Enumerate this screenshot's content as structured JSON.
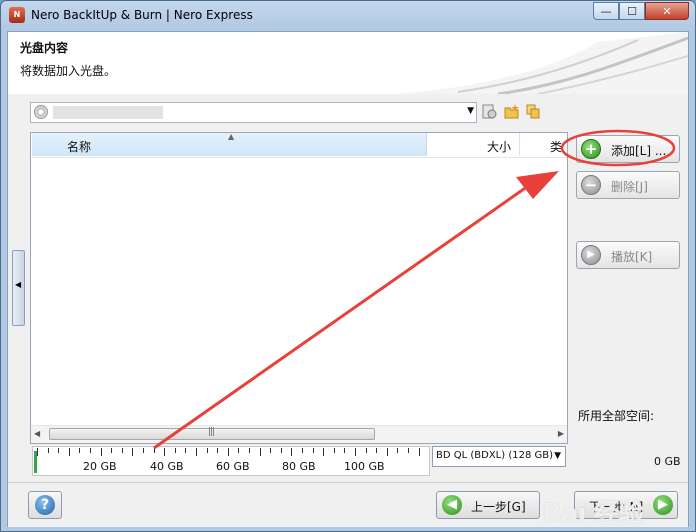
{
  "window": {
    "title": "Nero BackItUp & Burn | Nero Express",
    "app_icon": "nero-icon",
    "controls": {
      "minimize": "—",
      "maximize": "☐",
      "close": "✕"
    }
  },
  "header": {
    "title": "光盘内容",
    "subtitle": "将数据加入光盘。"
  },
  "source": {
    "value": "███████"
  },
  "table": {
    "columns": [
      "名称",
      "大小",
      "类"
    ],
    "rows": []
  },
  "buttons": {
    "add": "添加[L] ...",
    "delete": "删除[J]",
    "play": "播放[K]"
  },
  "space": {
    "label": "所用全部空间:",
    "value": "0 GB"
  },
  "ruler": {
    "labels": [
      "20 GB",
      "40 GB",
      "60 GB",
      "80 GB",
      "100 GB"
    ],
    "used_fraction": 0
  },
  "disc_type": {
    "selected": "BD QL (BDXL) (128 GB)"
  },
  "footer": {
    "help": "?",
    "back": "上一步[G]",
    "next": "下一步[N]"
  },
  "watermark": "Bai 经验",
  "colors": {
    "annotation_red": "#e8403a",
    "accent_green": "#2f8f1f",
    "header_blue": "#cfe6f7"
  }
}
